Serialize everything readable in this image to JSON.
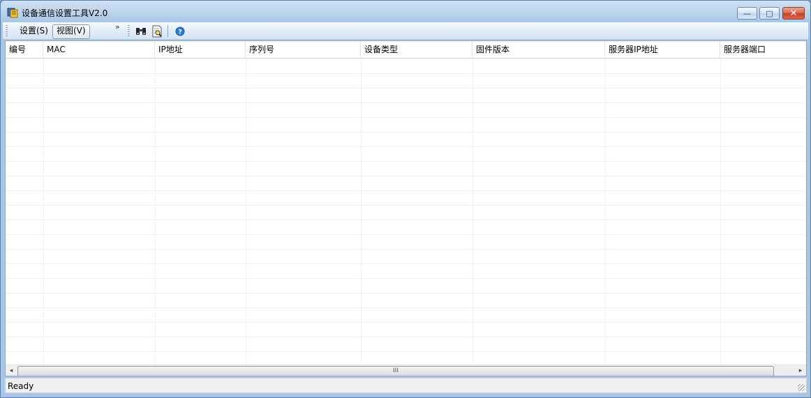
{
  "window": {
    "title": "设备通信设置工具V2.0",
    "controls": {
      "minimize": "—",
      "maximize": "□",
      "close": "✕"
    }
  },
  "toolbar": {
    "menus": [
      "设置(S)",
      "视图(V)"
    ],
    "overflow_glyph": "»",
    "icons": [
      "binoculars-icon",
      "document-search-icon",
      "help-icon"
    ]
  },
  "table": {
    "columns": [
      "编号",
      "MAC",
      "IP地址",
      "序列号",
      "设备类型",
      "固件版本",
      "服务器IP地址",
      "服务器端口"
    ],
    "rows": []
  },
  "scrollbar": {
    "left_arrow": "◂",
    "right_arrow": "▸",
    "thumb_grip": "III"
  },
  "statusbar": {
    "text": "Ready"
  },
  "colors": {
    "window_frame": "#a9c6e6",
    "close_button": "#c43f22",
    "help_icon": "#2a7bd6"
  }
}
